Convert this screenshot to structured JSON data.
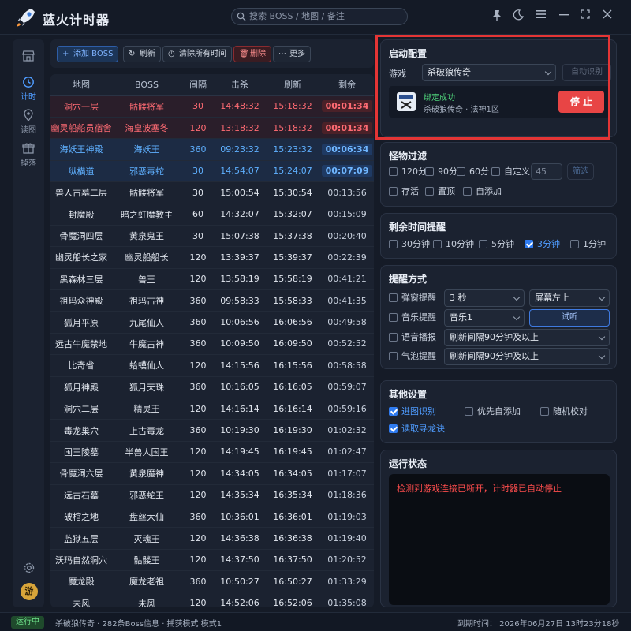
{
  "app": {
    "title": "蓝火计时器"
  },
  "search": {
    "placeholder": "搜索 BOSS / 地图 / 备注"
  },
  "window_controls": [
    "pin-icon",
    "moon-icon",
    "menu-icon",
    "minimize-icon",
    "maximize-icon",
    "close-icon"
  ],
  "sidebar": {
    "items": [
      {
        "icon": "shop-icon",
        "label": ""
      },
      {
        "icon": "clock-icon",
        "label": "计时"
      },
      {
        "icon": "map-pin-icon",
        "label": "读图"
      },
      {
        "icon": "gift-icon",
        "label": "掉落"
      }
    ],
    "avatar": "游"
  },
  "toolbar": {
    "add": "添加 BOSS",
    "refresh": "刷新",
    "clear": "清除所有时间",
    "delete": "删除",
    "more": "更多"
  },
  "table": {
    "headers": [
      "地图",
      "BOSS",
      "间隔",
      "击杀",
      "刷新",
      "剩余"
    ],
    "rows": [
      {
        "style": "red",
        "cells": [
          "洞穴一层",
          "骷髅将军",
          "30",
          "14:48:32",
          "15:18:32",
          "00:01:34"
        ]
      },
      {
        "style": "red",
        "cells": [
          "幽灵船船员宿舍",
          "海皇波塞冬",
          "120",
          "13:18:32",
          "15:18:32",
          "00:01:34"
        ]
      },
      {
        "style": "blue",
        "cells": [
          "海妖王神殿",
          "海妖王",
          "360",
          "09:23:32",
          "15:23:32",
          "00:06:34"
        ]
      },
      {
        "style": "blue",
        "cells": [
          "纵横道",
          "邪恶毒蛇",
          "30",
          "14:54:07",
          "15:24:07",
          "00:07:09"
        ]
      },
      {
        "style": "normal",
        "cells": [
          "兽人古墓二层",
          "骷髅将军",
          "30",
          "15:00:54",
          "15:30:54",
          "00:13:56"
        ]
      },
      {
        "style": "normal",
        "cells": [
          "封魔殿",
          "暗之虹魔教主",
          "60",
          "14:32:07",
          "15:32:07",
          "00:15:09"
        ]
      },
      {
        "style": "normal",
        "cells": [
          "骨魔洞四层",
          "黄泉鬼王",
          "30",
          "15:07:38",
          "15:37:38",
          "00:20:40"
        ]
      },
      {
        "style": "normal",
        "cells": [
          "幽灵船长之家",
          "幽灵船船长",
          "120",
          "13:39:37",
          "15:39:37",
          "00:22:39"
        ]
      },
      {
        "style": "normal",
        "cells": [
          "黑森林三层",
          "兽王",
          "120",
          "13:58:19",
          "15:58:19",
          "00:41:21"
        ]
      },
      {
        "style": "normal",
        "cells": [
          "祖玛众神殿",
          "祖玛古神",
          "360",
          "09:58:33",
          "15:58:33",
          "00:41:35"
        ]
      },
      {
        "style": "normal",
        "cells": [
          "狐月平原",
          "九尾仙人",
          "360",
          "10:06:56",
          "16:06:56",
          "00:49:58"
        ]
      },
      {
        "style": "normal",
        "cells": [
          "远古牛魔禁地",
          "牛魔古神",
          "360",
          "10:09:50",
          "16:09:50",
          "00:52:52"
        ]
      },
      {
        "style": "normal",
        "cells": [
          "比奇省",
          "蛤蟆仙人",
          "120",
          "14:15:56",
          "16:15:56",
          "00:58:58"
        ]
      },
      {
        "style": "normal",
        "cells": [
          "狐月神殿",
          "狐月天珠",
          "360",
          "10:16:05",
          "16:16:05",
          "00:59:07"
        ]
      },
      {
        "style": "normal",
        "cells": [
          "洞穴二层",
          "精灵王",
          "120",
          "14:16:14",
          "16:16:14",
          "00:59:16"
        ]
      },
      {
        "style": "normal",
        "cells": [
          "毒龙巢穴",
          "上古毒龙",
          "360",
          "10:19:30",
          "16:19:30",
          "01:02:32"
        ]
      },
      {
        "style": "normal",
        "cells": [
          "国王陵墓",
          "半兽人国王",
          "120",
          "14:19:45",
          "16:19:45",
          "01:02:47"
        ]
      },
      {
        "style": "normal",
        "cells": [
          "骨魔洞六层",
          "黄泉魔神",
          "120",
          "14:34:05",
          "16:34:05",
          "01:17:07"
        ]
      },
      {
        "style": "normal",
        "cells": [
          "远古石墓",
          "邪恶蛇王",
          "120",
          "14:35:34",
          "16:35:34",
          "01:18:36"
        ]
      },
      {
        "style": "normal",
        "cells": [
          "破棺之地",
          "盘丝大仙",
          "360",
          "10:36:01",
          "16:36:01",
          "01:19:03"
        ]
      },
      {
        "style": "normal",
        "cells": [
          "监狱五层",
          "灭魂王",
          "120",
          "14:36:38",
          "16:36:38",
          "01:19:40"
        ]
      },
      {
        "style": "normal",
        "cells": [
          "沃玛自然洞穴",
          "骷髅王",
          "120",
          "14:37:50",
          "16:37:50",
          "01:20:52"
        ]
      },
      {
        "style": "normal",
        "cells": [
          "魔龙殿",
          "魔龙老祖",
          "360",
          "10:50:27",
          "16:50:27",
          "01:33:29"
        ]
      },
      {
        "style": "normal",
        "cells": [
          "未风",
          "未风",
          "120",
          "14:52:06",
          "16:52:06",
          "01:35:08"
        ]
      }
    ]
  },
  "launch": {
    "title": "启动配置",
    "game_label": "游戏",
    "game_value": "杀破狼传奇",
    "auto_detect": "自动识别",
    "bind_status": "绑定成功",
    "bind_detail": "杀破狼传奇 · 法神1区",
    "stop": "停 止"
  },
  "filter": {
    "title": "怪物过滤",
    "options": [
      {
        "label": "120分",
        "checked": false
      },
      {
        "label": "90分",
        "checked": false
      },
      {
        "label": "60分",
        "checked": false
      },
      {
        "label": "自定义",
        "checked": false
      }
    ],
    "custom_value": "45",
    "filter_btn": "筛选",
    "extras": [
      {
        "label": "存活",
        "checked": false
      },
      {
        "label": "置顶",
        "checked": false
      },
      {
        "label": "自添加",
        "checked": false
      }
    ]
  },
  "remind_time": {
    "title": "剩余时间提醒",
    "options": [
      {
        "label": "30分钟",
        "checked": false
      },
      {
        "label": "10分钟",
        "checked": false
      },
      {
        "label": "5分钟",
        "checked": false
      },
      {
        "label": "3分钟",
        "checked": true
      },
      {
        "label": "1分钟",
        "checked": false
      }
    ]
  },
  "remind_mode": {
    "title": "提醒方式",
    "rows": [
      {
        "label": "弹窗提醒",
        "sel1": "3 秒",
        "sel2": "屏幕左上"
      },
      {
        "label": "音乐提醒",
        "sel1": "音乐1",
        "btn": "试听"
      },
      {
        "label": "语音播报",
        "sel1": "刷新间隔90分钟及以上"
      },
      {
        "label": "气泡提醒",
        "sel1": "刷新间隔90分钟及以上"
      }
    ]
  },
  "other": {
    "title": "其他设置",
    "options": [
      {
        "label": "进图识别",
        "checked": true
      },
      {
        "label": "优先自添加",
        "checked": false
      },
      {
        "label": "随机校对",
        "checked": false
      },
      {
        "label": "读取寻龙诀",
        "checked": true
      }
    ]
  },
  "run_status": {
    "title": "运行状态",
    "log": "检测到游戏连接已断开，计时器已自动停止"
  },
  "statusbar": {
    "badge": "运行中",
    "info": "杀破狼传奇 · 282条Boss信息 · 捕获模式 模式1",
    "expiry": "到期时间： 2026年06月27日 13时23分18秒"
  },
  "colors": {
    "accent": "#2f7bf0",
    "danger": "#e84545",
    "alert_red": "#ff6b73",
    "highlight_blue": "#5fb0ff",
    "highlight_frame": "#e43535"
  }
}
